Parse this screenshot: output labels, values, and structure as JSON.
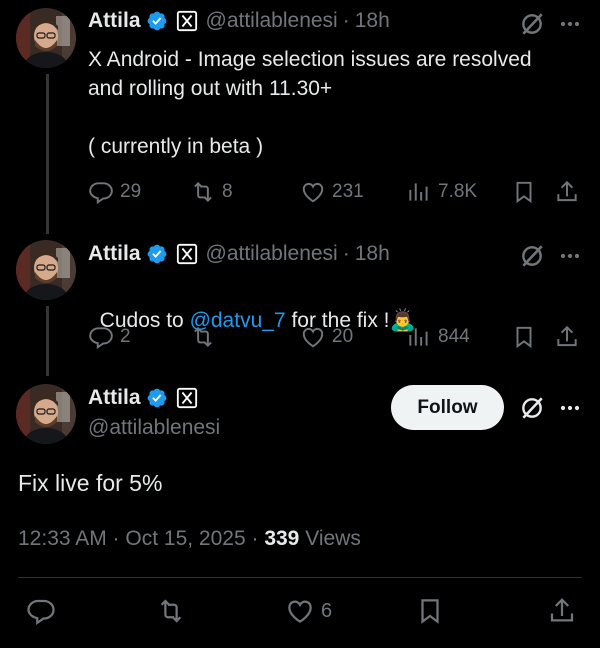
{
  "tweets": [
    {
      "author": "Attila",
      "handle": "@attilablenesi",
      "time": "18h",
      "text": "X Android - Image selection issues are resolved\nand rolling out with 11.30+\n\n( currently in beta )",
      "replies": "29",
      "reposts": "8",
      "likes": "231",
      "views": "7.8K"
    },
    {
      "author": "Attila",
      "handle": "@attilablenesi",
      "time": "18h",
      "text_before": "Cudos to ",
      "mention": "@datvu_7",
      "text_after": " for the fix !",
      "emoji": "🙇‍♂️",
      "replies": "2",
      "reposts": "",
      "likes": "20",
      "views": "844"
    }
  ],
  "main": {
    "author": "Attila",
    "handle": "@attilablenesi",
    "follow_label": "Follow",
    "text": "Fix live for 5%",
    "timestamp": "12:33 AM · Oct 15, 2025 · ",
    "views_count": "339",
    "views_label": " Views",
    "likes": "6"
  },
  "colors": {
    "accent": "#1d9bf0",
    "muted": "#71767b",
    "text": "#e7e9ea",
    "background": "#000000"
  }
}
